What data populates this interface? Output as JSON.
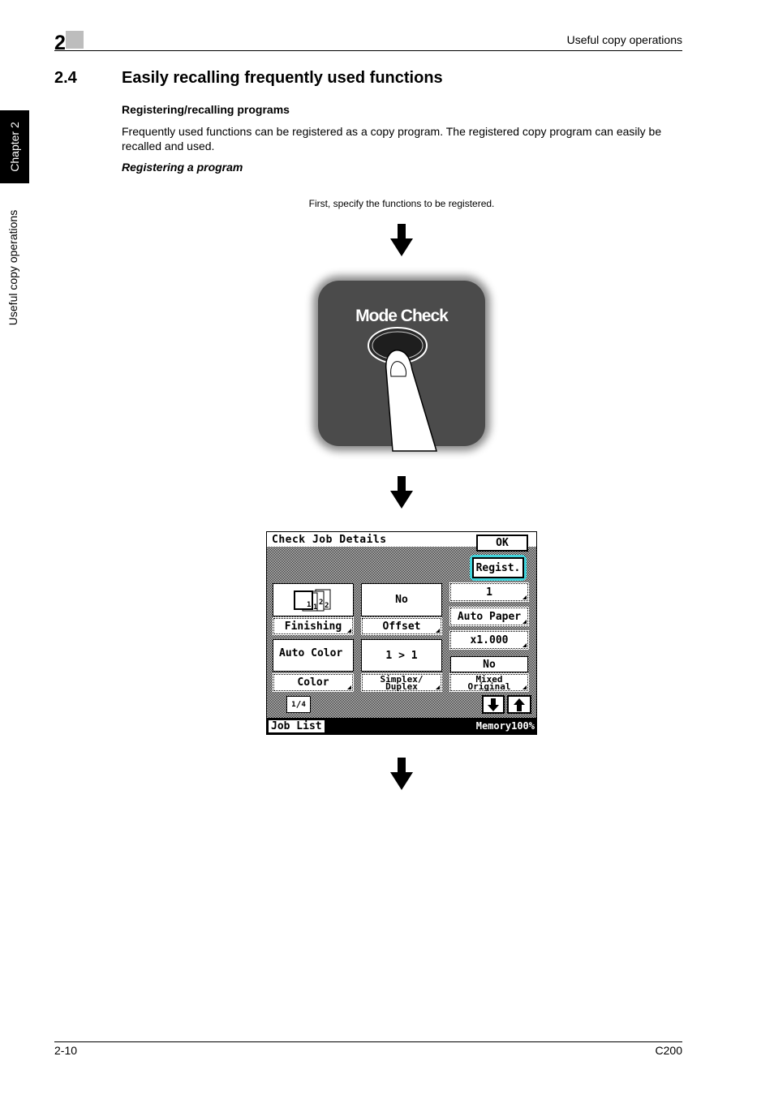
{
  "header": {
    "chapter_number": "2",
    "running_title": "Useful copy operations"
  },
  "side_tab": {
    "chapter_label": "Chapter 2",
    "section_label": "Useful copy operations"
  },
  "section": {
    "number": "2.4",
    "title": "Easily recalling frequently used functions",
    "subheading": "Registering/recalling programs",
    "paragraph": "Frequently used functions can be registered as a copy program. The registered copy program can easily be recalled and used.",
    "subheading_italic": "Registering a program"
  },
  "steps": {
    "caption": "First, specify the functions to be registered.",
    "arrow_icon": "down-arrow-icon",
    "mode_check_label": "Mode Check"
  },
  "screen": {
    "title": "Check Job Details",
    "ok_label": "OK",
    "regist_label": "Regist.",
    "highlight_color": "#3fd4dc",
    "finishing_icon_digits": [
      "1",
      "1",
      "2",
      "2"
    ],
    "finishing_label": "Finishing",
    "offset_value": "No",
    "offset_label": "Offset",
    "copies_value": "1",
    "paper_label": "Auto Paper",
    "zoom_value": "x1.000",
    "color_value": "Auto Color",
    "color_label": "Color",
    "duplex_value": "1 > 1",
    "duplex_label_line1": "Simplex/",
    "duplex_label_line2": "Duplex",
    "mixed_value": "No",
    "mixed_label_line1": "Mixed",
    "mixed_label_line2": "Original",
    "page_numerator": "1",
    "page_denominator": "4",
    "down_icon": "down-arrow-icon",
    "up_icon": "up-arrow-icon",
    "job_list_label": "Job List",
    "memory_label": "Memory100%"
  },
  "footer": {
    "page_number": "2-10",
    "model": "C200"
  }
}
